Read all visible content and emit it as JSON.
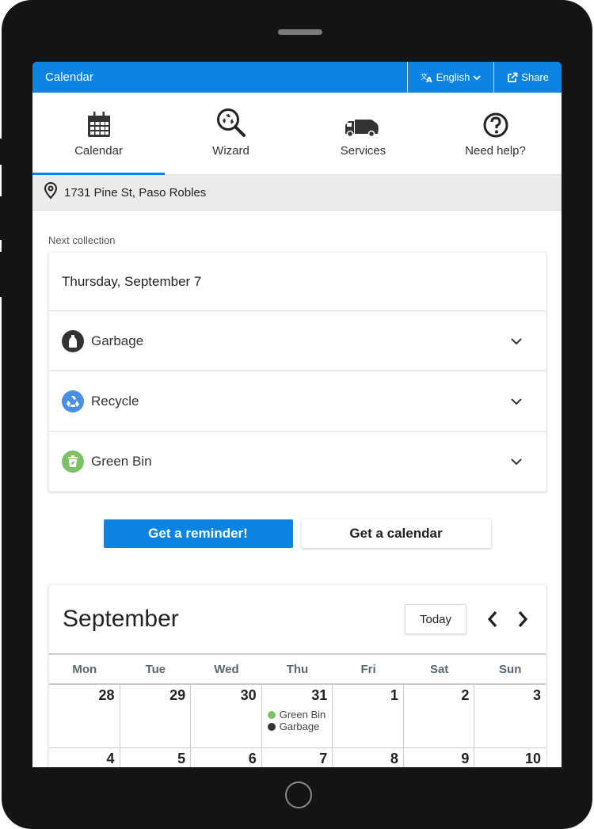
{
  "topbar": {
    "title": "Calendar",
    "language_label": "English",
    "share_label": "Share"
  },
  "nav": {
    "items": [
      {
        "label": "Calendar",
        "icon": "calendar-icon",
        "active": true
      },
      {
        "label": "Wizard",
        "icon": "recycle-search-icon",
        "active": false
      },
      {
        "label": "Services",
        "icon": "garbage-truck-icon",
        "active": false
      },
      {
        "label": "Need help?",
        "icon": "help-icon",
        "active": false
      }
    ]
  },
  "address": {
    "icon": "map-pin-icon",
    "text": "1731 Pine St, Paso Robles"
  },
  "next_collection": {
    "label": "Next collection",
    "date": "Thursday, September 7",
    "items": [
      {
        "label": "Garbage",
        "icon": "garbage-bag-icon",
        "color": "#333333"
      },
      {
        "label": "Recycle",
        "icon": "recycle-icon",
        "color": "#4a90e2"
      },
      {
        "label": "Green Bin",
        "icon": "green-bin-icon",
        "color": "#7cc067"
      }
    ]
  },
  "actions": {
    "reminder_label": "Get a reminder!",
    "calendar_label": "Get a calendar"
  },
  "calendar": {
    "month": "September",
    "today_label": "Today",
    "weekdays": [
      "Mon",
      "Tue",
      "Wed",
      "Thu",
      "Fri",
      "Sat",
      "Sun"
    ],
    "weeks": [
      [
        {
          "day": "28",
          "events": []
        },
        {
          "day": "29",
          "events": []
        },
        {
          "day": "30",
          "events": []
        },
        {
          "day": "31",
          "events": [
            {
              "label": "Green Bin",
              "color": "#7cc067"
            },
            {
              "label": "Garbage",
              "color": "#333333"
            }
          ]
        },
        {
          "day": "1",
          "events": []
        },
        {
          "day": "2",
          "events": []
        },
        {
          "day": "3",
          "events": []
        }
      ],
      [
        {
          "day": "4",
          "events": []
        },
        {
          "day": "5",
          "events": []
        },
        {
          "day": "6",
          "events": []
        },
        {
          "day": "7",
          "events": []
        },
        {
          "day": "8",
          "events": []
        },
        {
          "day": "9",
          "events": []
        },
        {
          "day": "10",
          "events": []
        }
      ]
    ]
  },
  "colors": {
    "brand": "#0a84e0",
    "garbage": "#333333",
    "recycle": "#4a90e2",
    "green_bin": "#7cc067"
  }
}
